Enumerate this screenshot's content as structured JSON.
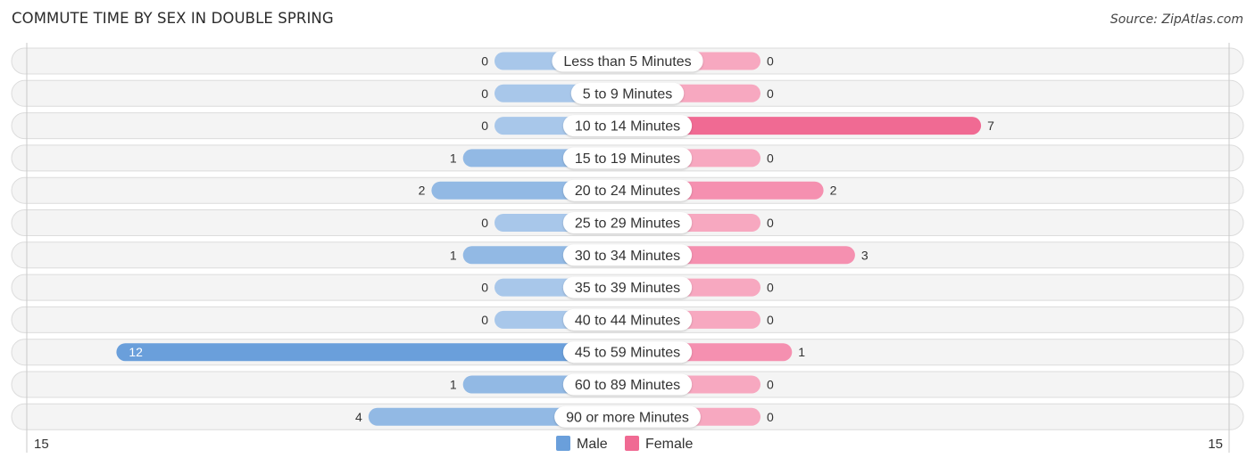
{
  "header": {
    "title": "COMMUTE TIME BY SEX IN DOUBLE SPRING",
    "source": "Source: ZipAtlas.com"
  },
  "colors": {
    "male": "#6a9fdb",
    "male_light": "#a8c7ea",
    "female": "#f06a93",
    "female_light": "#f7a8c0",
    "row_bg": "#f4f4f4"
  },
  "chart_data": {
    "type": "bar",
    "orientation": "horizontal-diverging",
    "title": "COMMUTE TIME BY SEX IN DOUBLE SPRING",
    "categories": [
      "Less than 5 Minutes",
      "5 to 9 Minutes",
      "10 to 14 Minutes",
      "15 to 19 Minutes",
      "20 to 24 Minutes",
      "25 to 29 Minutes",
      "30 to 34 Minutes",
      "35 to 39 Minutes",
      "40 to 44 Minutes",
      "45 to 59 Minutes",
      "60 to 89 Minutes",
      "90 or more Minutes"
    ],
    "series": [
      {
        "name": "Male",
        "values": [
          0,
          0,
          0,
          1,
          2,
          0,
          1,
          0,
          0,
          12,
          1,
          4
        ]
      },
      {
        "name": "Female",
        "values": [
          0,
          0,
          7,
          0,
          2,
          0,
          3,
          0,
          0,
          1,
          0,
          0
        ]
      }
    ],
    "axis": {
      "left_label": "15",
      "right_label": "15",
      "max": 15
    },
    "legend": {
      "position": "bottom-center",
      "items": [
        "Male",
        "Female"
      ]
    },
    "grid": false
  }
}
